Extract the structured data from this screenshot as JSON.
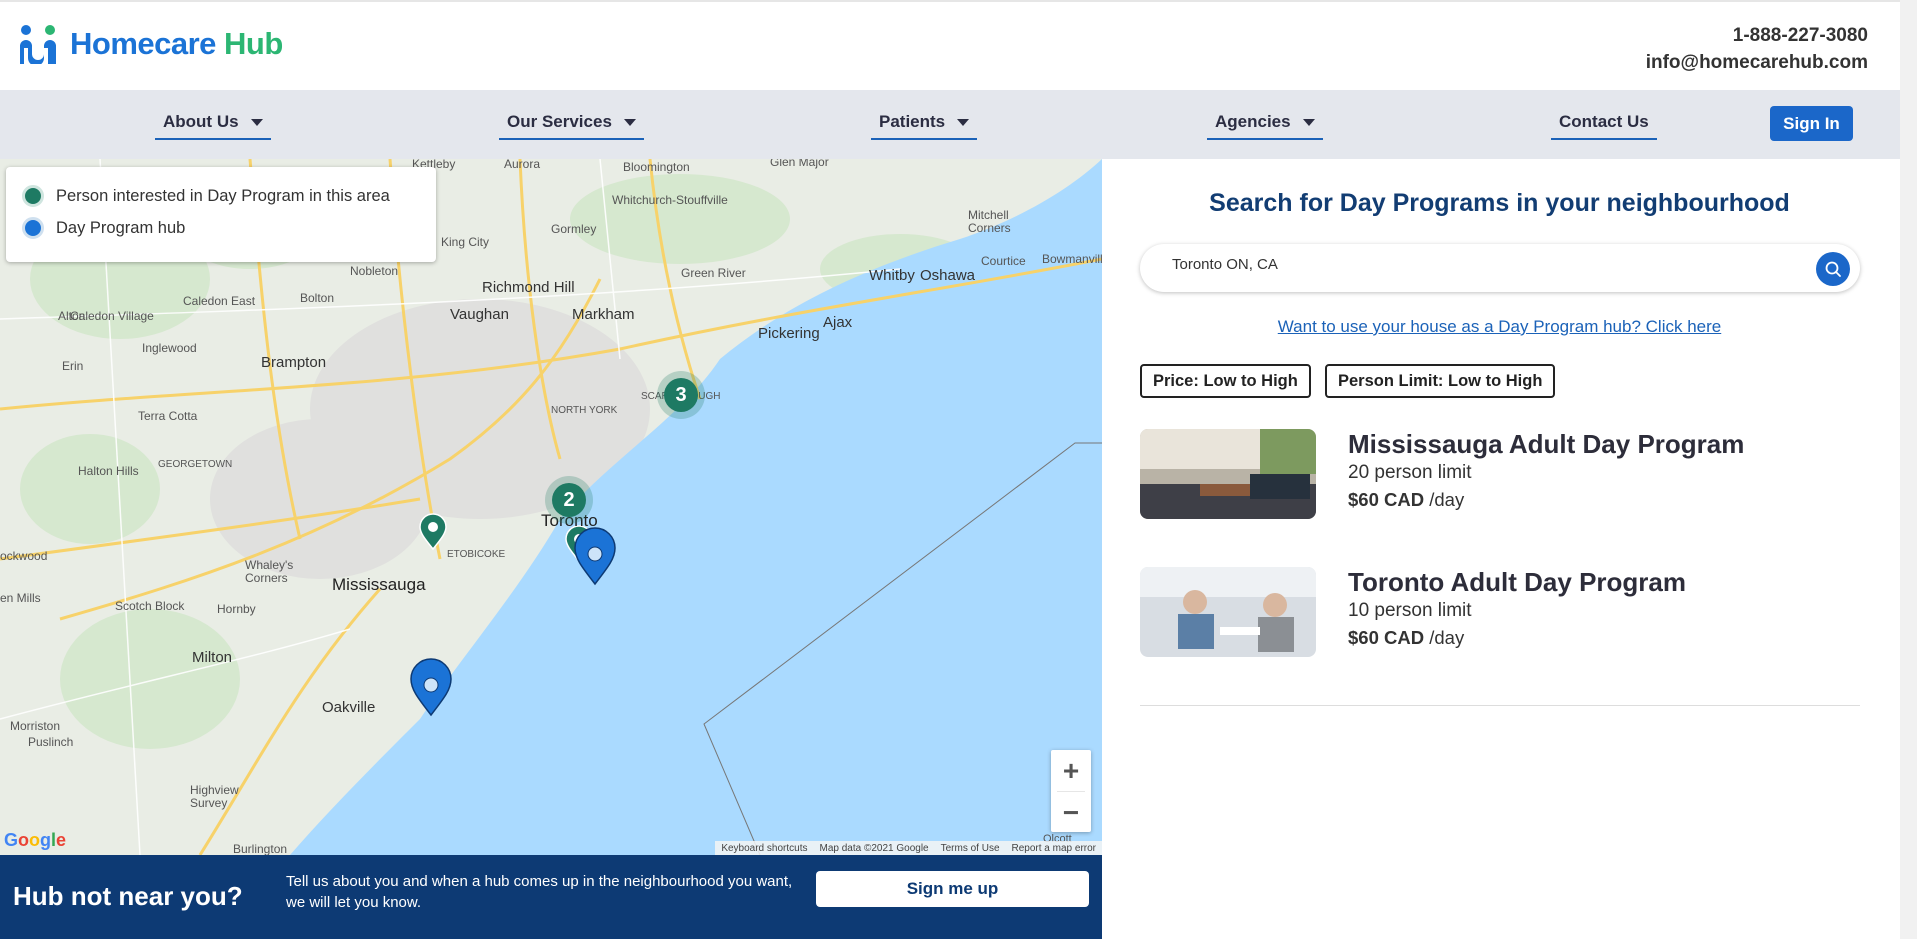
{
  "brand": {
    "name_part1": "Homecare",
    "name_part2": "Hub",
    "phone": "1-888-227-3080",
    "email": "info@homecarehub.com",
    "color_primary": "#1b73d6",
    "color_accent": "#2cb673"
  },
  "nav": {
    "items": [
      "About Us",
      "Our Services",
      "Patients",
      "Agencies",
      "Contact Us"
    ],
    "signin_label": "Sign In"
  },
  "map": {
    "legend": [
      {
        "label": "Person interested in Day Program in this area",
        "color": "#1e7a63"
      },
      {
        "label": "Day Program hub",
        "color": "#1b73d6"
      }
    ],
    "labels": {
      "toronto": "Toronto",
      "mississauga": "Mississauga",
      "brampton": "Brampton",
      "oakville": "Oakville",
      "richmond_hill": "Richmond Hill",
      "vaughan": "Vaughan",
      "markham": "Markham",
      "pickering": "Pickering",
      "ajax": "Ajax",
      "whitby": "Whitby",
      "oshawa": "Oshawa",
      "milton": "Milton",
      "burlington": "Burlington",
      "aurora": "Aurora",
      "king_city": "King City",
      "nobleton": "Nobleton",
      "bolton": "Bolton",
      "caledon_east": "Caledon East",
      "georgetown": "GEORGETOWN",
      "halton_hills": "Halton Hills",
      "north_york": "NORTH YORK",
      "etobicoke": "ETOBICOKE",
      "scarborough": "SCARBOROUGH",
      "whitchurch": "Whitchurch-Stouffville",
      "bloomington": "Bloomington",
      "gormley": "Gormley",
      "green_river": "Green River",
      "terra_cotta": "Terra Cotta",
      "inglewood": "Inglewood",
      "erin": "Erin",
      "alton": "Alton",
      "caledon_village": "Caledon Village",
      "scotch_block": "Scotch Block",
      "hornby": "Hornby",
      "whaleys_corners": "Whaley's Corners",
      "morriston": "Morriston",
      "puslinch": "Puslinch",
      "highview_survey": "Highview Survey",
      "kettleby": "Kettleby",
      "glen_major": "Glen Major",
      "mitchell_corners": "Mitchell Corners",
      "courtice": "Courtice",
      "bowmanville": "Bowmanvill",
      "glen_mills": "en Mills",
      "rockwood": "ockwood",
      "olcott": "Olcott"
    },
    "clusters": [
      "3",
      "2"
    ],
    "zoom_in": "+",
    "zoom_out": "−",
    "google": "Google",
    "attribution": [
      "Keyboard shortcuts",
      "Map data ©2021 Google",
      "Terms of Use",
      "Report a map error"
    ]
  },
  "banner": {
    "title": "Hub not near you?",
    "text": "Tell us about you and when a hub comes up in the neighbourhood you want, we will let you know.",
    "button": "Sign me up"
  },
  "panel": {
    "title": "Search for Day Programs in your neighbourhood",
    "search_value": "Toronto ON, CA",
    "hub_link": "Want to use your house as a Day Program hub? Click here",
    "sort_price": "Price: Low to High",
    "sort_limit": "Person Limit: Low to High",
    "programs": [
      {
        "name": "Mississauga Adult Day Program",
        "limit": "20 person limit",
        "price": "$60 CAD",
        "per": " /day"
      },
      {
        "name": "Toronto Adult Day Program",
        "limit": "10 person limit",
        "price": "$60 CAD",
        "per": " /day"
      }
    ]
  }
}
